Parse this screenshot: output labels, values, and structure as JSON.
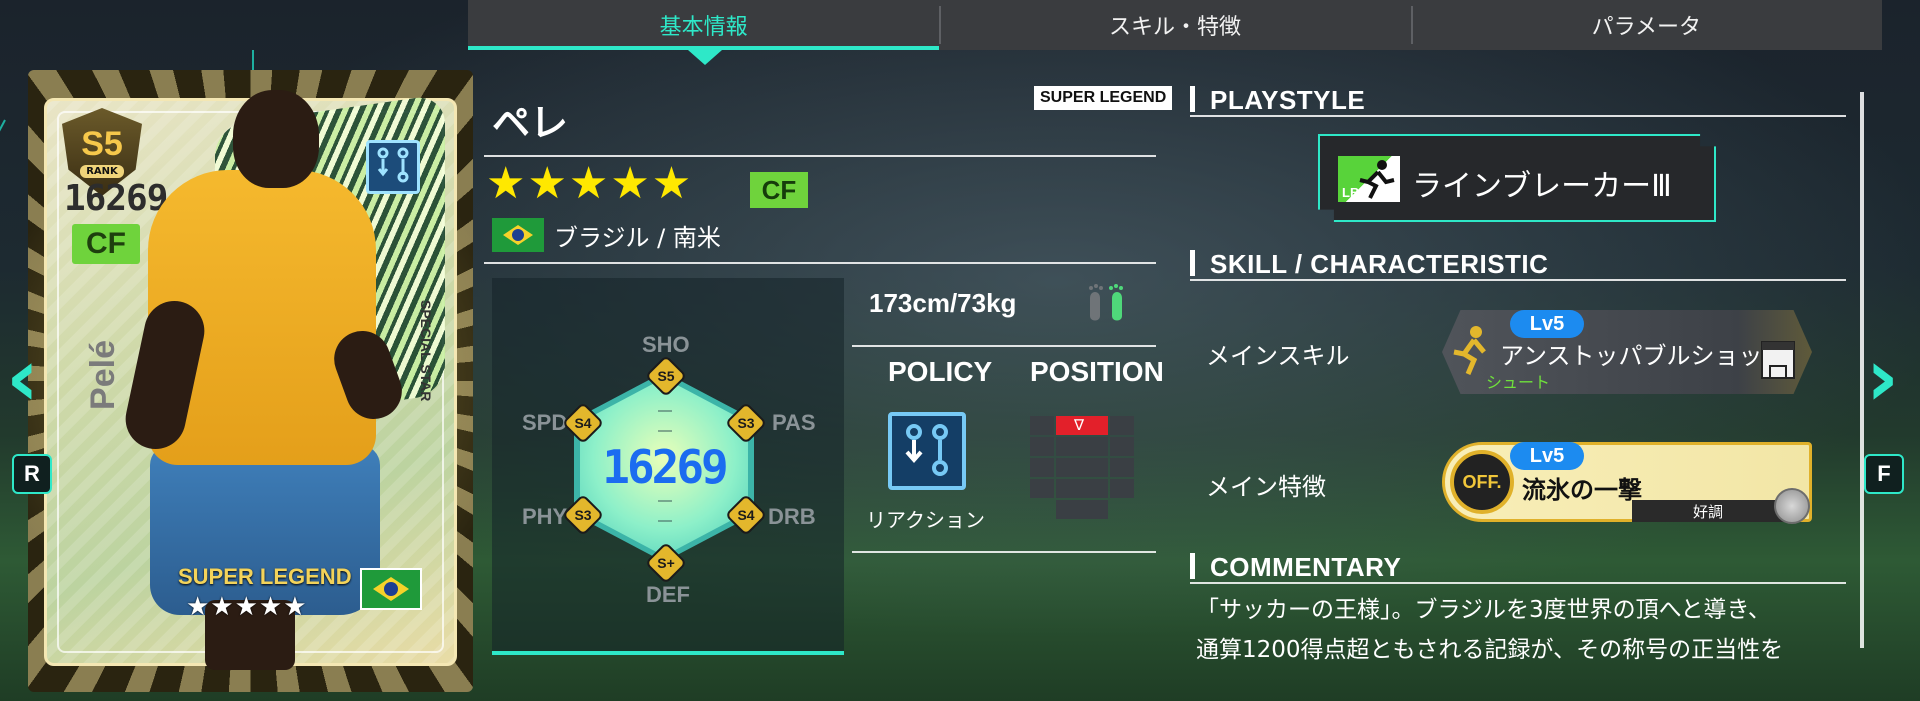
{
  "tabs": [
    {
      "label": "基本情報",
      "active": true
    },
    {
      "label": "スキル・特徴",
      "active": false
    },
    {
      "label": "パラメータ",
      "active": false
    }
  ],
  "card": {
    "rank": "S5",
    "rank_label": "RANK",
    "rating": "16269",
    "position": "CF",
    "name": "Pelé",
    "vertical_tag": "SPECIAL STAR",
    "legend_label": "SUPER LEGEND",
    "stars": "★★★★★",
    "policy_icon": "reaction-policy-icon",
    "flag_icon": "brazil-flag-icon"
  },
  "player": {
    "name": "ペレ",
    "rarity_tag": "SUPER LEGEND",
    "stars": "★★★★★",
    "position": "CF",
    "nationality": "ブラジル / 南米",
    "physique": "173cm/73kg",
    "feet_icon": "both-feet-icon"
  },
  "stats": {
    "overall": "16269",
    "items": [
      {
        "label": "SHO",
        "rank": "S5"
      },
      {
        "label": "PAS",
        "rank": "S3"
      },
      {
        "label": "DRB",
        "rank": "S4"
      },
      {
        "label": "DEF",
        "rank": "S+"
      },
      {
        "label": "PHY",
        "rank": "S3"
      },
      {
        "label": "SPD",
        "rank": "S4"
      }
    ]
  },
  "policy": {
    "header": "POLICY",
    "label": "リアクション"
  },
  "position_map": {
    "header": "POSITION",
    "marker": "∇"
  },
  "sections": {
    "playstyle": "PLAYSTYLE",
    "skill": "SKILL / CHARACTERISTIC",
    "commentary": "COMMENTARY"
  },
  "playstyle": {
    "code": "LBK",
    "name": "ラインブレーカーⅢ"
  },
  "main_skill": {
    "row_label": "メインスキル",
    "level": "Lv5",
    "name": "アンストッパブルショット",
    "category": "シュート"
  },
  "main_trait": {
    "row_label": "メイン特徴",
    "level": "Lv5",
    "badge": "OFF.",
    "name": "流氷の一撃",
    "status": "好調"
  },
  "commentary": {
    "line1": "「サッカーの王様」。ブラジルを3度世界の頂へと導き、",
    "line2": "通算1200得点超ともされる記録が、その称号の正当性を"
  },
  "side": {
    "left_arrow": "‹",
    "right_arrow": "›",
    "left_key": "R",
    "right_key": "F"
  },
  "colors": {
    "accent": "#2ee8c8",
    "star": "#ffe800",
    "cf_badge": "#6fd33c",
    "level_pill": "#1c8bf0"
  }
}
